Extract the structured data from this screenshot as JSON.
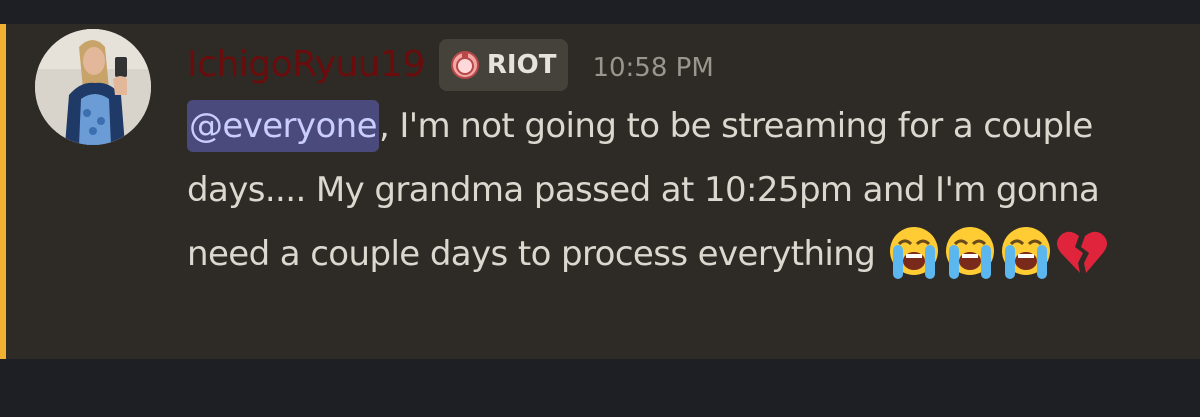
{
  "message": {
    "author": {
      "username": "IchigoRyuu19",
      "role_tag": "RIOT",
      "avatar_icon": "user-avatar-photo"
    },
    "timestamp": "10:58 PM",
    "mention": "@everyone",
    "text_after_mention": ", I'm not going to be streaming for a couple days.... My grandma passed at 10:25pm and I'm gonna need a couple days to process everything",
    "emojis": [
      "loudly-crying-face-icon",
      "loudly-crying-face-icon",
      "loudly-crying-face-icon",
      "broken-heart-icon"
    ]
  },
  "colors": {
    "background": "#1e1f24",
    "message_highlight": "#2e2b26",
    "mention_bar": "#f0b132",
    "username": "#6b0c0c",
    "mention_bg": "#4a4a7c",
    "mention_text": "#c9ceff",
    "body_text": "#dcd8cf",
    "timestamp": "#9a968d"
  }
}
